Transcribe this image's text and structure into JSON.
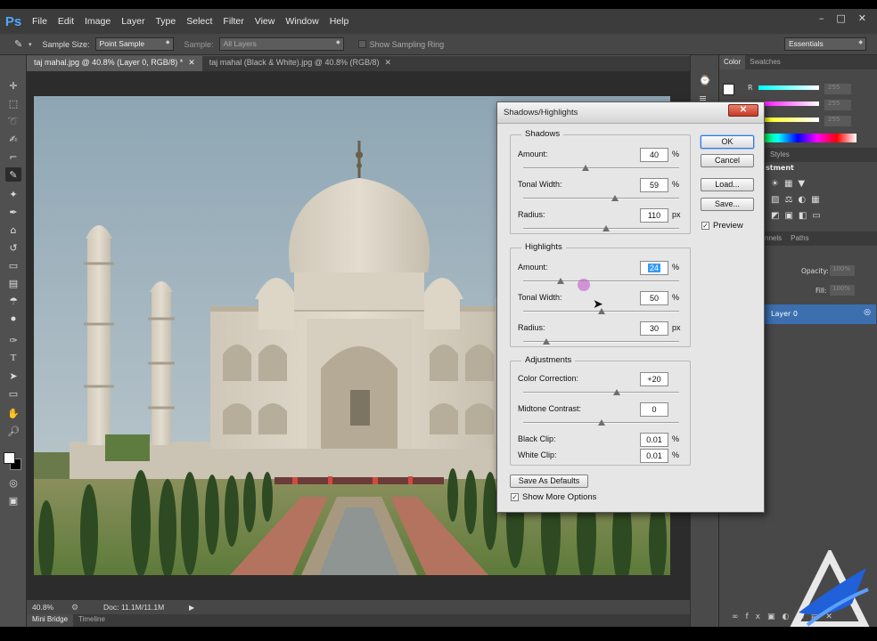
{
  "app": {
    "logo": "Ps",
    "menu": [
      "File",
      "Edit",
      "Image",
      "Layer",
      "Type",
      "Select",
      "Filter",
      "View",
      "Window",
      "Help"
    ],
    "window_controls": [
      "–",
      "□",
      "✕"
    ]
  },
  "options_bar": {
    "sample_size_label": "Sample Size:",
    "sample_size_value": "Point Sample",
    "sample_label": "Sample:",
    "sample_value": "All Layers",
    "sampling_ring_label": "Show Sampling Ring",
    "workspace": "Essentials"
  },
  "tabs": [
    {
      "label": "taj mahal.jpg @ 40.8% (Layer 0, RGB/8) *",
      "close": "✕"
    },
    {
      "label": "taj mahal (Black & White).jpg @ 40.8% (RGB/8)",
      "close": "✕"
    }
  ],
  "status": {
    "zoom": "40.8%",
    "doc": "Doc: 11.1M/11.1M"
  },
  "bottom_tabs": [
    "Mini Bridge",
    "Timeline"
  ],
  "panels": {
    "color_tabs": [
      "Color",
      "Swatches"
    ],
    "channel_r": "R",
    "color_values": [
      "255",
      "255",
      "255"
    ],
    "adjust_tabs": [
      "Styles"
    ],
    "adjust_label": "stment",
    "layers_tabs": [
      "nnels",
      "Paths"
    ],
    "opacity_label": "Opacity:",
    "opacity_value": "100%",
    "fill_label": "Fill:",
    "fill_value": "100%",
    "layer_name": "Layer 0"
  },
  "dialog": {
    "title": "Shadows/Highlights",
    "close": "✕",
    "shadows": {
      "label": "Shadows",
      "amount": {
        "label": "Amount:",
        "value": "40",
        "unit": "%",
        "slider": 0.4
      },
      "tonal": {
        "label": "Tonal Width:",
        "value": "59",
        "unit": "%",
        "slider": 0.59
      },
      "radius": {
        "label": "Radius:",
        "value": "110",
        "unit": "px",
        "slider": 0.53
      }
    },
    "highlights": {
      "label": "Highlights",
      "amount": {
        "label": "Amount:",
        "value": "24",
        "unit": "%",
        "slider": 0.24
      },
      "tonal": {
        "label": "Tonal Width:",
        "value": "50",
        "unit": "%",
        "slider": 0.5
      },
      "radius": {
        "label": "Radius:",
        "value": "30",
        "unit": "px",
        "slider": 0.15
      }
    },
    "adjustments": {
      "label": "Adjustments",
      "color": {
        "label": "Color Correction:",
        "value": "+20",
        "slider": 0.6
      },
      "midtone": {
        "label": "Midtone Contrast:",
        "value": "0",
        "slider": 0.5
      },
      "black_clip": {
        "label": "Black Clip:",
        "value": "0.01",
        "unit": "%"
      },
      "white_clip": {
        "label": "White Clip:",
        "value": "0.01",
        "unit": "%"
      }
    },
    "buttons": {
      "ok": "OK",
      "cancel": "Cancel",
      "load": "Load...",
      "save": "Save...",
      "save_defaults": "Save As Defaults"
    },
    "preview_label": "Preview",
    "preview_checked": true,
    "more_options_label": "Show More Options",
    "more_options_checked": true
  }
}
